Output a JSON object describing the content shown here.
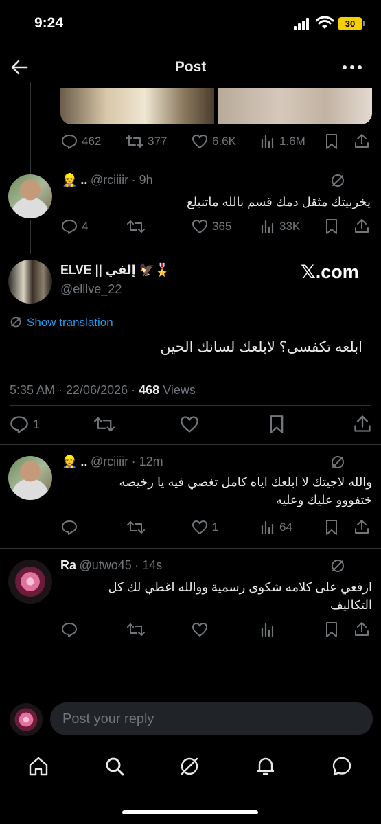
{
  "status_bar": {
    "time": "9:24",
    "battery": "30"
  },
  "header": {
    "title": "Post"
  },
  "tweet_top": {
    "actions": {
      "replies": "462",
      "reposts": "377",
      "likes": "6.6K",
      "views": "1.6M"
    }
  },
  "reply1": {
    "name": "👷 ..",
    "handle": "@rciiiir",
    "time": "· 9h",
    "text": "يخربيتك مثقل دمك قسم بالله ماتنبلع",
    "actions": {
      "replies": "4",
      "reposts": "",
      "likes": "365",
      "views": "33K"
    }
  },
  "main_post": {
    "name": "ELVE || إلفي 🦅🎖️",
    "handle": "@elllve_22",
    "watermark": "𝕏.com",
    "translate_label": "Show translation",
    "text": "ابلعه تكفسى؟ لابلعك لسانك الحين",
    "timestamp": "5:35 AM · 22/06/2026 · ",
    "views_count": "468",
    "views_label": "Views",
    "actions": {
      "replies": "1"
    }
  },
  "reply2": {
    "name": "👷 ..",
    "handle": "@rciiiir",
    "time": "· 12m",
    "text_line1": "والله لاجيتك لا ابلعك اياه كامل تغصي فيه يا رخيصه",
    "text_line2": "ختفووو عليك وعليه",
    "actions": {
      "likes": "1",
      "views": "64"
    }
  },
  "reply3": {
    "name": "Ra",
    "handle": "@utwo45",
    "time": "· 14s",
    "text_line1": "ارفعي على كلامه شكوى رسمية ووالله اغطي لك كل",
    "text_line2": "التكاليف"
  },
  "composer": {
    "placeholder": "Post your reply"
  },
  "tabbar": [
    "home-icon",
    "search-icon",
    "grok-icon",
    "notifications-icon",
    "messages-icon"
  ]
}
